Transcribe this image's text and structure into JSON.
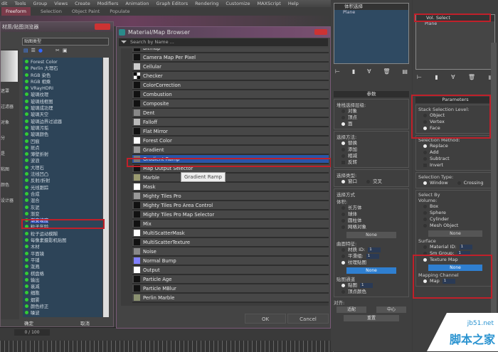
{
  "menubar": [
    "dit",
    "Tools",
    "Group",
    "Views",
    "Create",
    "Modifiers",
    "Animation",
    "Graph Editors",
    "Rendering",
    "Customize",
    "MAXScript",
    "Help"
  ],
  "ribbon": [
    "Freeform",
    "Selection",
    "Object Paint",
    "Populate"
  ],
  "left_dialog": {
    "title": "材质/贴图浏览器",
    "filter": "贴图类型",
    "side_labels": [
      "遮罩",
      "过滤器",
      "对象",
      "分",
      "是",
      "粘图",
      "颜色",
      "设计器"
    ],
    "items": [
      "Forest Color",
      "Perlin 大理石",
      "RGB 染色",
      "RGB 相乘",
      "VRayHDRI",
      "玻璃纹理",
      "玻璃线框图",
      "玻璃成功理",
      "玻璃天空",
      "玻璃边界过滤器",
      "玻璃污垢",
      "玻璃颜色",
      "凹痕",
      "斑点",
      "薄壁折射",
      "波浪",
      "大理石",
      "法线凹凸",
      "反射/折射",
      "光线跟踪",
      "合成",
      "混合",
      "灰泥",
      "渐变",
      "渐变坡度",
      "粒子年龄",
      "粒子运动模糊",
      "每像素摄影机贴图",
      "木材",
      "平面镜",
      "平铺",
      "泼溅",
      "棋盘格",
      "输出",
      "衰减",
      "细胞",
      "烟雾",
      "颜色修正",
      "噪波"
    ],
    "selected": "渐变坡度",
    "ok": "确定",
    "cancel": "取消"
  },
  "timeline": {
    "frame": "0 / 100"
  },
  "browser": {
    "title": "Material/Map Browser",
    "search_placeholder": "Search by Name ...",
    "items": [
      {
        "n": "Bitmap",
        "c": "#111"
      },
      {
        "n": "Camera Map Per Pixel",
        "c": "#111"
      },
      {
        "n": "Cellular",
        "c": "#ccc"
      },
      {
        "n": "Checker",
        "c": "checker"
      },
      {
        "n": "ColorCorrection",
        "c": "#111"
      },
      {
        "n": "Combustion",
        "c": "#111"
      },
      {
        "n": "Composite",
        "c": "#111"
      },
      {
        "n": "Dent",
        "c": "#888"
      },
      {
        "n": "Falloff",
        "c": "#bbb"
      },
      {
        "n": "Flat Mirror",
        "c": "#111"
      },
      {
        "n": "Forest Color",
        "c": "#fff"
      },
      {
        "n": "Gradient",
        "c": "#999"
      },
      {
        "n": "Gradient Ramp",
        "c": "#777"
      },
      {
        "n": "Map Output Selector",
        "c": "#111"
      },
      {
        "n": "Marble",
        "c": "#9a9a70"
      },
      {
        "n": "Mask",
        "c": "#fff"
      },
      {
        "n": "Mighty Tiles Pro",
        "c": "#999"
      },
      {
        "n": "Mighty Tiles Pro Area Control",
        "c": "#111"
      },
      {
        "n": "Mighty Tiles Pro Map Selector",
        "c": "#111"
      },
      {
        "n": "Mix",
        "c": "#111"
      },
      {
        "n": "MultiScatterMask",
        "c": "#fff"
      },
      {
        "n": "MultiScatterTexture",
        "c": "#111"
      },
      {
        "n": "Noise",
        "c": "#888"
      },
      {
        "n": "Normal Bump",
        "c": "#8080ff"
      },
      {
        "n": "Output",
        "c": "#fff"
      },
      {
        "n": "Particle Age",
        "c": "#111"
      },
      {
        "n": "Particle MBlur",
        "c": "#111"
      },
      {
        "n": "Perlin Marble",
        "c": "#8a9070"
      }
    ],
    "selected": "Gradient Ramp",
    "tooltip": "Gradient Ramp",
    "ok": "OK",
    "cancel": "Cancel"
  },
  "cn_panel": {
    "stack_title": "体积选择",
    "stack_sub": "Plane",
    "rollout": "参数",
    "stack_level": "堆栈选择层级:",
    "levels": [
      "对象",
      "顶点",
      "面"
    ],
    "method": "选择方法:",
    "methods": [
      "替换",
      "添加",
      "相减",
      "反转"
    ],
    "type": "选择类型:",
    "types": [
      "窗口",
      "交叉"
    ],
    "select_by": "选择方式",
    "volume": "体积:",
    "volumes": [
      "长方体",
      "球体",
      "圆柱体",
      "网格对象"
    ],
    "none": "None",
    "surface": "曲面特征:",
    "surfaces": [
      "材质 ID:",
      "平滑组:",
      "纹理贴图"
    ],
    "spin": "1",
    "channel": "贴图通道",
    "channels": [
      "贴图",
      "顶点颜色"
    ],
    "align": "对齐:",
    "align_btns": [
      "适配",
      "中心"
    ],
    "reset": "重置"
  },
  "en_panel": {
    "stack_title": "Vol. Select",
    "stack_sub": "Plane",
    "rollout": "Parameters",
    "stack_level": "Stack Selection Level:",
    "levels": [
      "Object",
      "Vertex",
      "Face"
    ],
    "method": "Selection Method:",
    "methods": [
      "Replace",
      "Add",
      "Subtract",
      "Invert"
    ],
    "type": "Selection Type:",
    "types": [
      "Window",
      "Crossing"
    ],
    "select_by": "Select By",
    "volume": "Volume:",
    "volumes": [
      "Box",
      "Sphere",
      "Cylinder",
      "Mesh Object"
    ],
    "none": "None",
    "surface": "Surface",
    "surfaces": [
      "Material ID:",
      "Sm Group:",
      "Texture Map"
    ],
    "spin": "1",
    "channel": "Mapping Channel",
    "channels": [
      "Map"
    ]
  },
  "watermark": {
    "a": "jb51.net",
    "b": "脚本之家"
  }
}
